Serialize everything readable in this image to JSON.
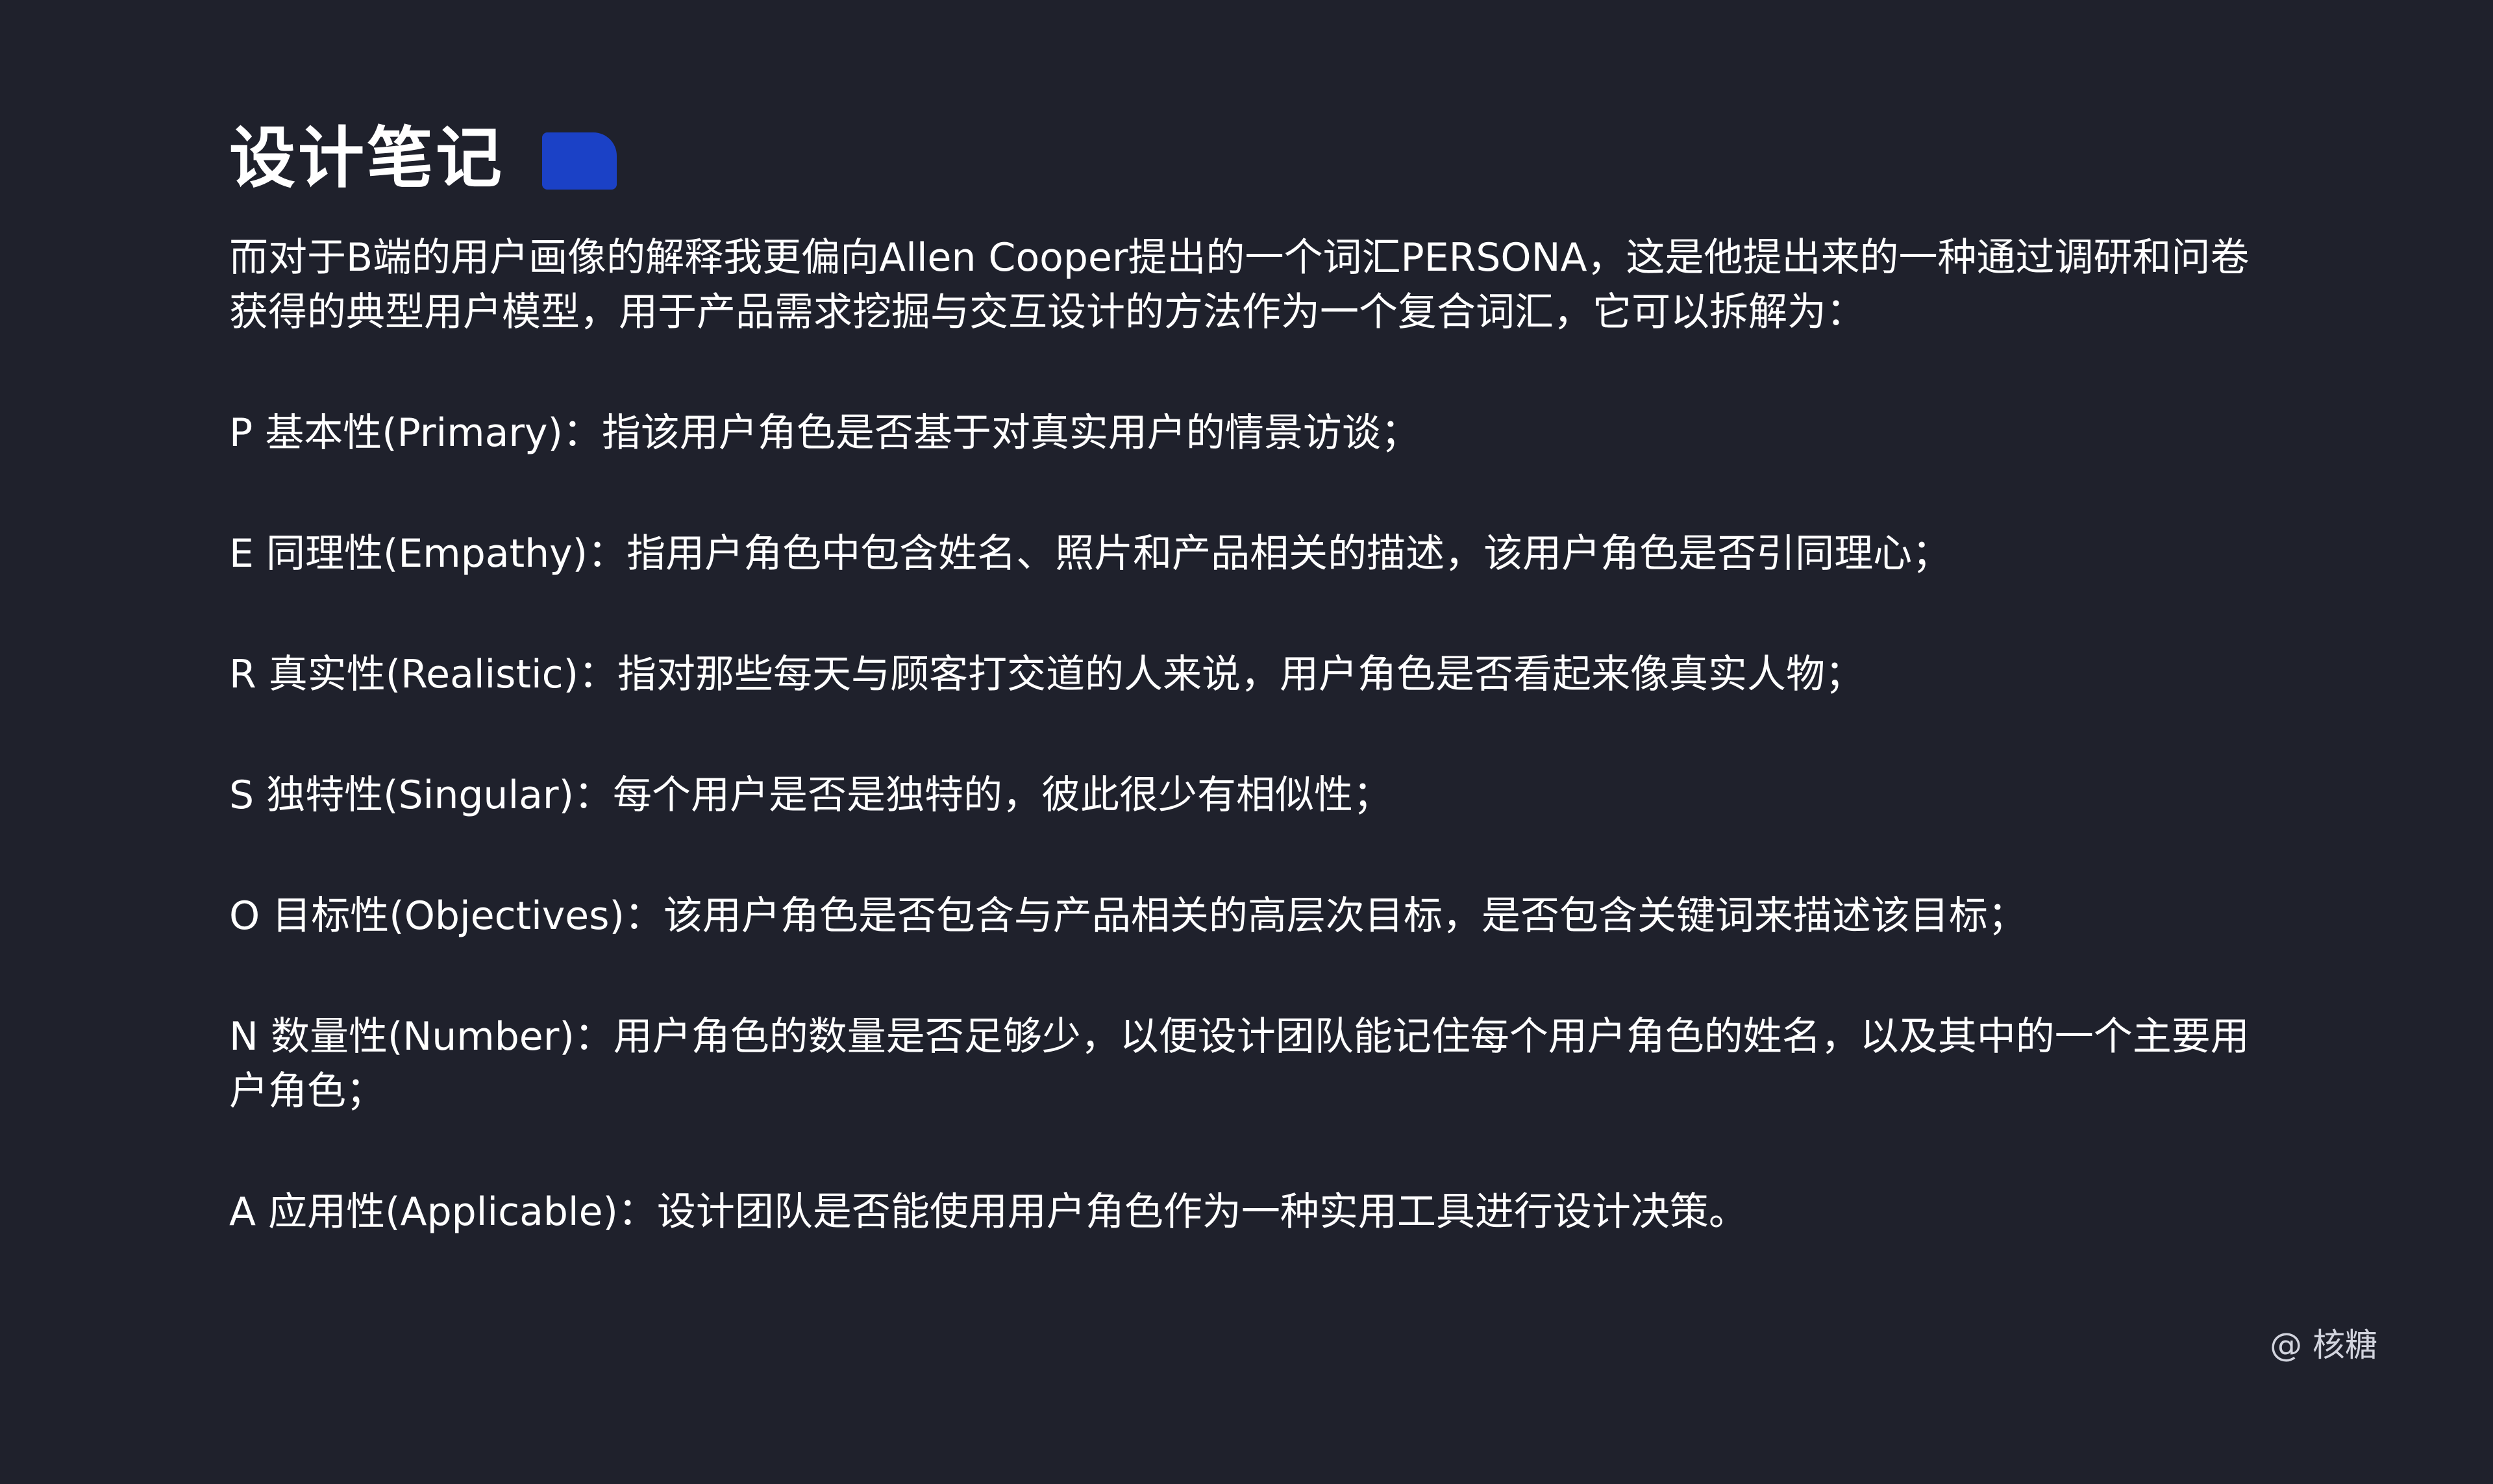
{
  "title": "设计笔记",
  "intro": "而对于B端的用户画像的解释我更偏向Allen Cooper提出的一个词汇PERSONA，这是他提出来的一种通过调研和问卷获得的典型用户模型，用于产品需求挖掘与交互设计的方法作为一个复合词汇，它可以拆解为：",
  "items": [
    "P 基本性(Primary)：指该用户角色是否基于对真实用户的情景访谈；",
    "E 同理性(Empathy)：指用户角色中包含姓名、照片和产品相关的描述，该用户角色是否引同理心；",
    "R 真实性(Realistic)：指对那些每天与顾客打交道的人来说，用户角色是否看起来像真实人物；",
    "S 独特性(Singular)：每个用户是否是独特的，彼此很少有相似性；",
    "O 目标性(Objectives)：该用户角色是否包含与产品相关的高层次目标，是否包含关键词来描述该目标；",
    "N 数量性(Number)：用户角色的数量是否足够少，以便设计团队能记住每个用户角色的姓名，以及其中的一个主要用户角色；",
    "A 应用性(Applicable)：设计团队是否能使用用户角色作为一种实用工具进行设计决策。"
  ],
  "credit": "@ 核糖",
  "colors": {
    "background": "#1f212c",
    "accent": "#1b41c6",
    "text": "#ffffff"
  }
}
